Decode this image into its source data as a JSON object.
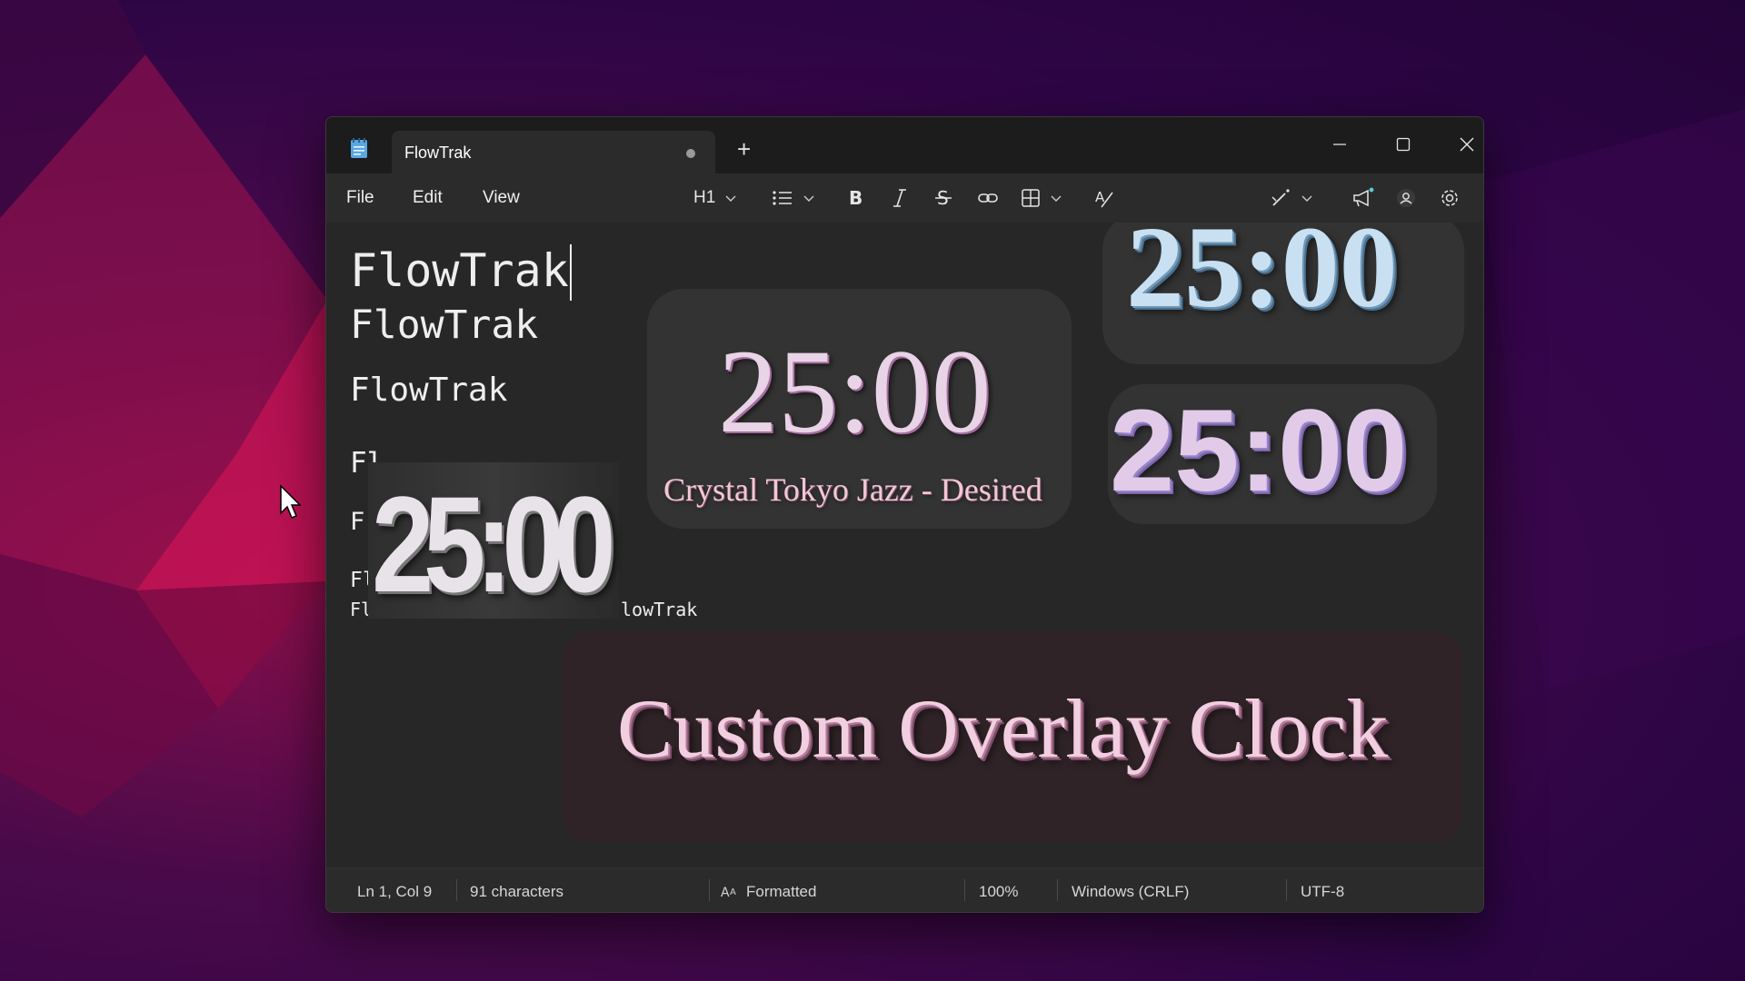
{
  "window": {
    "tab_title": "FlowTrak",
    "new_tab_symbol": "+"
  },
  "menu": {
    "file": "File",
    "edit": "Edit",
    "view": "View"
  },
  "toolbar": {
    "heading_label": "H1"
  },
  "editor": {
    "lines": [
      "FlowTrak",
      "FlowTrak",
      "FlowTrak",
      "Fl",
      "F",
      "Fl",
      "Fl"
    ],
    "partial_trailing_text": "lowTrak"
  },
  "overlays": {
    "gradient_clock": {
      "time": "25:00",
      "subtitle": "Crystal Tokyo Jazz - Desired"
    },
    "chrome_clock": {
      "time": "25:00"
    },
    "pastel_clock": {
      "time": "25:00"
    },
    "bold_clock": {
      "time": "25:00"
    },
    "banner": {
      "text": "Custom Overlay Clock"
    }
  },
  "statusbar": {
    "position": "Ln 1, Col 9",
    "characters": "91 characters",
    "format": "Formatted",
    "zoom": "100%",
    "line_ending": "Windows (CRLF)",
    "encoding": "UTF-8"
  },
  "colors": {
    "wallpaper_base": "#2e0545",
    "wallpaper_accent": "#b0124f",
    "window_bg": "#202020",
    "editor_bg": "#272727"
  }
}
